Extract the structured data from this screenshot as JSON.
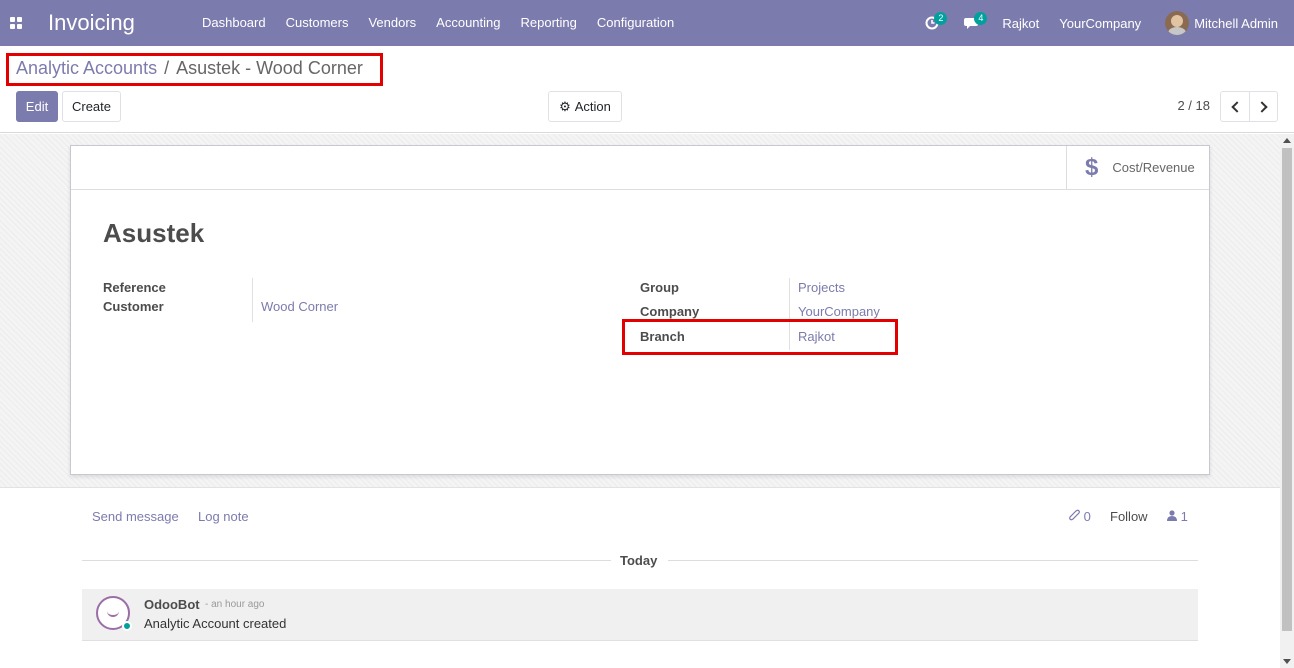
{
  "navbar": {
    "app_title": "Invoicing",
    "menu": [
      "Dashboard",
      "Customers",
      "Vendors",
      "Accounting",
      "Reporting",
      "Configuration"
    ],
    "activity_badge": "2",
    "messages_badge": "4",
    "branch": "Rajkot",
    "company": "YourCompany",
    "user": "Mitchell Admin",
    "color": "#7c7bad"
  },
  "breadcrumb": {
    "parent": "Analytic Accounts",
    "separator": "/",
    "current": "Asustek - Wood Corner"
  },
  "toolbar": {
    "edit_label": "Edit",
    "create_label": "Create",
    "action_label": "Action",
    "pager": "2 / 18"
  },
  "form": {
    "smart_button_label": "Cost/Revenue",
    "title": "Asustek",
    "left_fields": [
      {
        "label": "Reference",
        "value": ""
      },
      {
        "label": "Customer",
        "value": "Wood Corner"
      }
    ],
    "right_fields": [
      {
        "label": "Group",
        "value": "Projects"
      },
      {
        "label": "Company",
        "value": "YourCompany"
      },
      {
        "label": "Branch",
        "value": "Rajkot"
      }
    ]
  },
  "chatter": {
    "send_message": "Send message",
    "log_note": "Log note",
    "attachments_count": "0",
    "follow_label": "Follow",
    "followers_count": "1",
    "date_separator": "Today",
    "messages": [
      {
        "author": "OdooBot",
        "date": "- an hour ago",
        "body": "Analytic Account created"
      }
    ]
  },
  "icons": {
    "apps": "apps-grid-icon",
    "activity": "clock-icon",
    "messages": "chat-icon",
    "action": "gear-icon",
    "smart_button": "dollar-icon",
    "attachment": "paperclip-icon",
    "followers": "user-icon"
  },
  "highlight_color": "#e30000"
}
